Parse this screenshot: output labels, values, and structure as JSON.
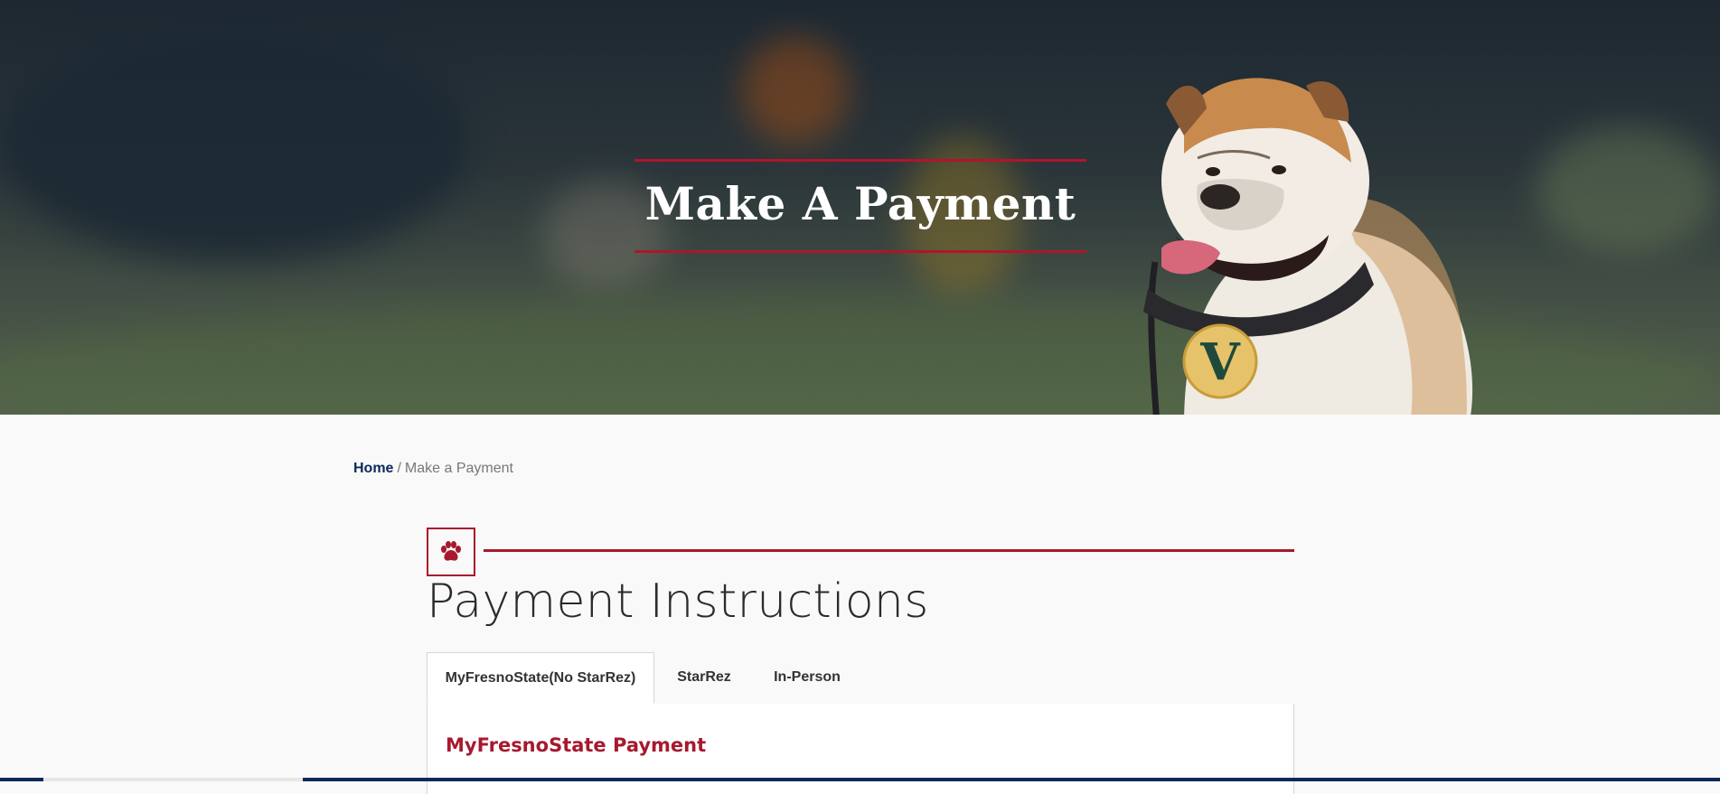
{
  "hero": {
    "title": "Make A Payment",
    "accent_color": "#b3132c",
    "tag_letter": "V"
  },
  "breadcrumb": {
    "home_label": "Home",
    "separator": "/",
    "current_label": "Make a Payment"
  },
  "section": {
    "icon": "paw-icon",
    "title": "Payment Instructions",
    "accent_color": "#a6192e"
  },
  "tabs": [
    {
      "label": "MyFresnoState(No StarRez)",
      "active": true
    },
    {
      "label": "StarRez",
      "active": false
    },
    {
      "label": "In-Person",
      "active": false
    }
  ],
  "panel": {
    "heading": "MyFresnoState Payment"
  }
}
